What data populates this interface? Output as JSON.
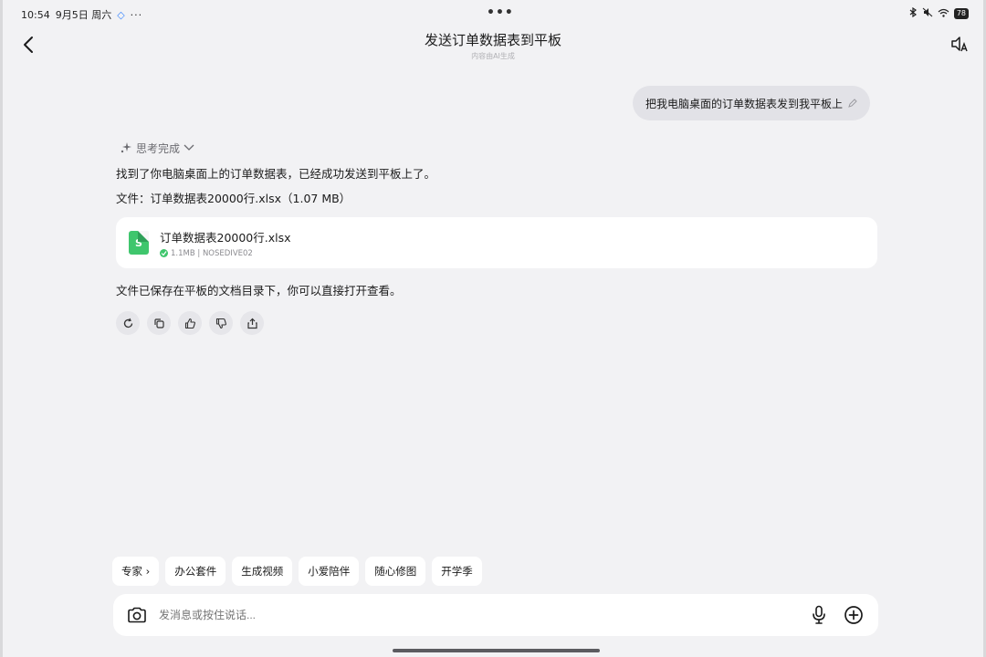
{
  "status_bar": {
    "time": "10:54",
    "date": "9月5日 周六",
    "extra_dots": "···",
    "center_dots": "•••",
    "battery": "78"
  },
  "header": {
    "back_icon": "chevron-left-icon",
    "title": "发送订单数据表到平板",
    "subtitle": "内容由AI生成",
    "speaker_icon": "speaker-translate-icon"
  },
  "user_message": {
    "text": "把我电脑桌面的订单数据表发到我平板上"
  },
  "assistant": {
    "thinking_label": "思考完成",
    "line1": "找到了你电脑桌面上的订单数据表，已经成功发送到平板上了。",
    "line2": "文件：订单数据表20000行.xlsx（1.07 MB）",
    "file_card": {
      "name": "订单数据表20000行.xlsx",
      "meta": "1.1MB | NOSEDIVE02",
      "icon_letter": "S"
    },
    "line3": "文件已保存在平板的文档目录下，你可以直接打开查看。",
    "actions": [
      "refresh-icon",
      "copy-icon",
      "thumbs-up-icon",
      "thumbs-down-icon",
      "share-icon"
    ]
  },
  "chips": [
    {
      "label": "专家 ›"
    },
    {
      "label": "办公套件"
    },
    {
      "label": "生成视频"
    },
    {
      "label": "小爱陪伴"
    },
    {
      "label": "随心修图"
    },
    {
      "label": "开学季"
    }
  ],
  "input": {
    "placeholder": "发消息或按住说话..."
  },
  "colors": {
    "background": "#f2f2f4",
    "bubble": "#e2e2e7",
    "excel_green": "#3fc66d"
  }
}
